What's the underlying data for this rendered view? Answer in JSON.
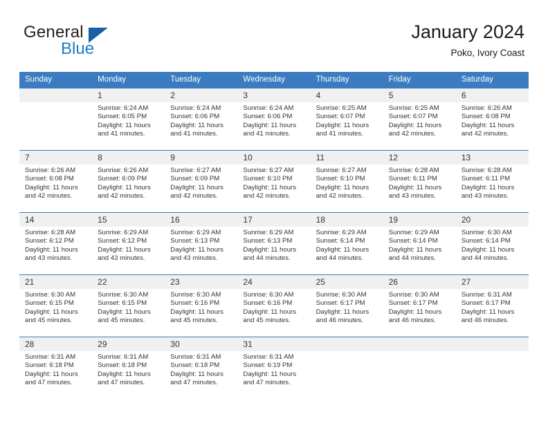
{
  "brand": {
    "name_top": "General",
    "name_bottom": "Blue",
    "accent_color": "#1760a5",
    "text_color": "#231f20"
  },
  "header": {
    "title": "January 2024",
    "subtitle": "Poko, Ivory Coast"
  },
  "theme": {
    "header_blue": "#3a7cbf",
    "daynum_bg": "#f0f0f0",
    "text": "#333333"
  },
  "weekday_headers": [
    "Sunday",
    "Monday",
    "Tuesday",
    "Wednesday",
    "Thursday",
    "Friday",
    "Saturday"
  ],
  "labels": {
    "sunrise": "Sunrise:",
    "sunset": "Sunset:",
    "daylight": "Daylight:"
  },
  "weeks": [
    [
      {
        "day": "",
        "sunrise": "",
        "sunset": "",
        "daylight": ""
      },
      {
        "day": "1",
        "sunrise": "Sunrise: 6:24 AM",
        "sunset": "Sunset: 6:05 PM",
        "daylight": "Daylight: 11 hours and 41 minutes."
      },
      {
        "day": "2",
        "sunrise": "Sunrise: 6:24 AM",
        "sunset": "Sunset: 6:06 PM",
        "daylight": "Daylight: 11 hours and 41 minutes."
      },
      {
        "day": "3",
        "sunrise": "Sunrise: 6:24 AM",
        "sunset": "Sunset: 6:06 PM",
        "daylight": "Daylight: 11 hours and 41 minutes."
      },
      {
        "day": "4",
        "sunrise": "Sunrise: 6:25 AM",
        "sunset": "Sunset: 6:07 PM",
        "daylight": "Daylight: 11 hours and 41 minutes."
      },
      {
        "day": "5",
        "sunrise": "Sunrise: 6:25 AM",
        "sunset": "Sunset: 6:07 PM",
        "daylight": "Daylight: 11 hours and 42 minutes."
      },
      {
        "day": "6",
        "sunrise": "Sunrise: 6:26 AM",
        "sunset": "Sunset: 6:08 PM",
        "daylight": "Daylight: 11 hours and 42 minutes."
      }
    ],
    [
      {
        "day": "7",
        "sunrise": "Sunrise: 6:26 AM",
        "sunset": "Sunset: 6:08 PM",
        "daylight": "Daylight: 11 hours and 42 minutes."
      },
      {
        "day": "8",
        "sunrise": "Sunrise: 6:26 AM",
        "sunset": "Sunset: 6:09 PM",
        "daylight": "Daylight: 11 hours and 42 minutes."
      },
      {
        "day": "9",
        "sunrise": "Sunrise: 6:27 AM",
        "sunset": "Sunset: 6:09 PM",
        "daylight": "Daylight: 11 hours and 42 minutes."
      },
      {
        "day": "10",
        "sunrise": "Sunrise: 6:27 AM",
        "sunset": "Sunset: 6:10 PM",
        "daylight": "Daylight: 11 hours and 42 minutes."
      },
      {
        "day": "11",
        "sunrise": "Sunrise: 6:27 AM",
        "sunset": "Sunset: 6:10 PM",
        "daylight": "Daylight: 11 hours and 42 minutes."
      },
      {
        "day": "12",
        "sunrise": "Sunrise: 6:28 AM",
        "sunset": "Sunset: 6:11 PM",
        "daylight": "Daylight: 11 hours and 43 minutes."
      },
      {
        "day": "13",
        "sunrise": "Sunrise: 6:28 AM",
        "sunset": "Sunset: 6:11 PM",
        "daylight": "Daylight: 11 hours and 43 minutes."
      }
    ],
    [
      {
        "day": "14",
        "sunrise": "Sunrise: 6:28 AM",
        "sunset": "Sunset: 6:12 PM",
        "daylight": "Daylight: 11 hours and 43 minutes."
      },
      {
        "day": "15",
        "sunrise": "Sunrise: 6:29 AM",
        "sunset": "Sunset: 6:12 PM",
        "daylight": "Daylight: 11 hours and 43 minutes."
      },
      {
        "day": "16",
        "sunrise": "Sunrise: 6:29 AM",
        "sunset": "Sunset: 6:13 PM",
        "daylight": "Daylight: 11 hours and 43 minutes."
      },
      {
        "day": "17",
        "sunrise": "Sunrise: 6:29 AM",
        "sunset": "Sunset: 6:13 PM",
        "daylight": "Daylight: 11 hours and 44 minutes."
      },
      {
        "day": "18",
        "sunrise": "Sunrise: 6:29 AM",
        "sunset": "Sunset: 6:14 PM",
        "daylight": "Daylight: 11 hours and 44 minutes."
      },
      {
        "day": "19",
        "sunrise": "Sunrise: 6:29 AM",
        "sunset": "Sunset: 6:14 PM",
        "daylight": "Daylight: 11 hours and 44 minutes."
      },
      {
        "day": "20",
        "sunrise": "Sunrise: 6:30 AM",
        "sunset": "Sunset: 6:14 PM",
        "daylight": "Daylight: 11 hours and 44 minutes."
      }
    ],
    [
      {
        "day": "21",
        "sunrise": "Sunrise: 6:30 AM",
        "sunset": "Sunset: 6:15 PM",
        "daylight": "Daylight: 11 hours and 45 minutes."
      },
      {
        "day": "22",
        "sunrise": "Sunrise: 6:30 AM",
        "sunset": "Sunset: 6:15 PM",
        "daylight": "Daylight: 11 hours and 45 minutes."
      },
      {
        "day": "23",
        "sunrise": "Sunrise: 6:30 AM",
        "sunset": "Sunset: 6:16 PM",
        "daylight": "Daylight: 11 hours and 45 minutes."
      },
      {
        "day": "24",
        "sunrise": "Sunrise: 6:30 AM",
        "sunset": "Sunset: 6:16 PM",
        "daylight": "Daylight: 11 hours and 45 minutes."
      },
      {
        "day": "25",
        "sunrise": "Sunrise: 6:30 AM",
        "sunset": "Sunset: 6:17 PM",
        "daylight": "Daylight: 11 hours and 46 minutes."
      },
      {
        "day": "26",
        "sunrise": "Sunrise: 6:30 AM",
        "sunset": "Sunset: 6:17 PM",
        "daylight": "Daylight: 11 hours and 46 minutes."
      },
      {
        "day": "27",
        "sunrise": "Sunrise: 6:31 AM",
        "sunset": "Sunset: 6:17 PM",
        "daylight": "Daylight: 11 hours and 46 minutes."
      }
    ],
    [
      {
        "day": "28",
        "sunrise": "Sunrise: 6:31 AM",
        "sunset": "Sunset: 6:18 PM",
        "daylight": "Daylight: 11 hours and 47 minutes."
      },
      {
        "day": "29",
        "sunrise": "Sunrise: 6:31 AM",
        "sunset": "Sunset: 6:18 PM",
        "daylight": "Daylight: 11 hours and 47 minutes."
      },
      {
        "day": "30",
        "sunrise": "Sunrise: 6:31 AM",
        "sunset": "Sunset: 6:18 PM",
        "daylight": "Daylight: 11 hours and 47 minutes."
      },
      {
        "day": "31",
        "sunrise": "Sunrise: 6:31 AM",
        "sunset": "Sunset: 6:19 PM",
        "daylight": "Daylight: 11 hours and 47 minutes."
      },
      {
        "day": "",
        "sunrise": "",
        "sunset": "",
        "daylight": ""
      },
      {
        "day": "",
        "sunrise": "",
        "sunset": "",
        "daylight": ""
      },
      {
        "day": "",
        "sunrise": "",
        "sunset": "",
        "daylight": ""
      }
    ]
  ]
}
